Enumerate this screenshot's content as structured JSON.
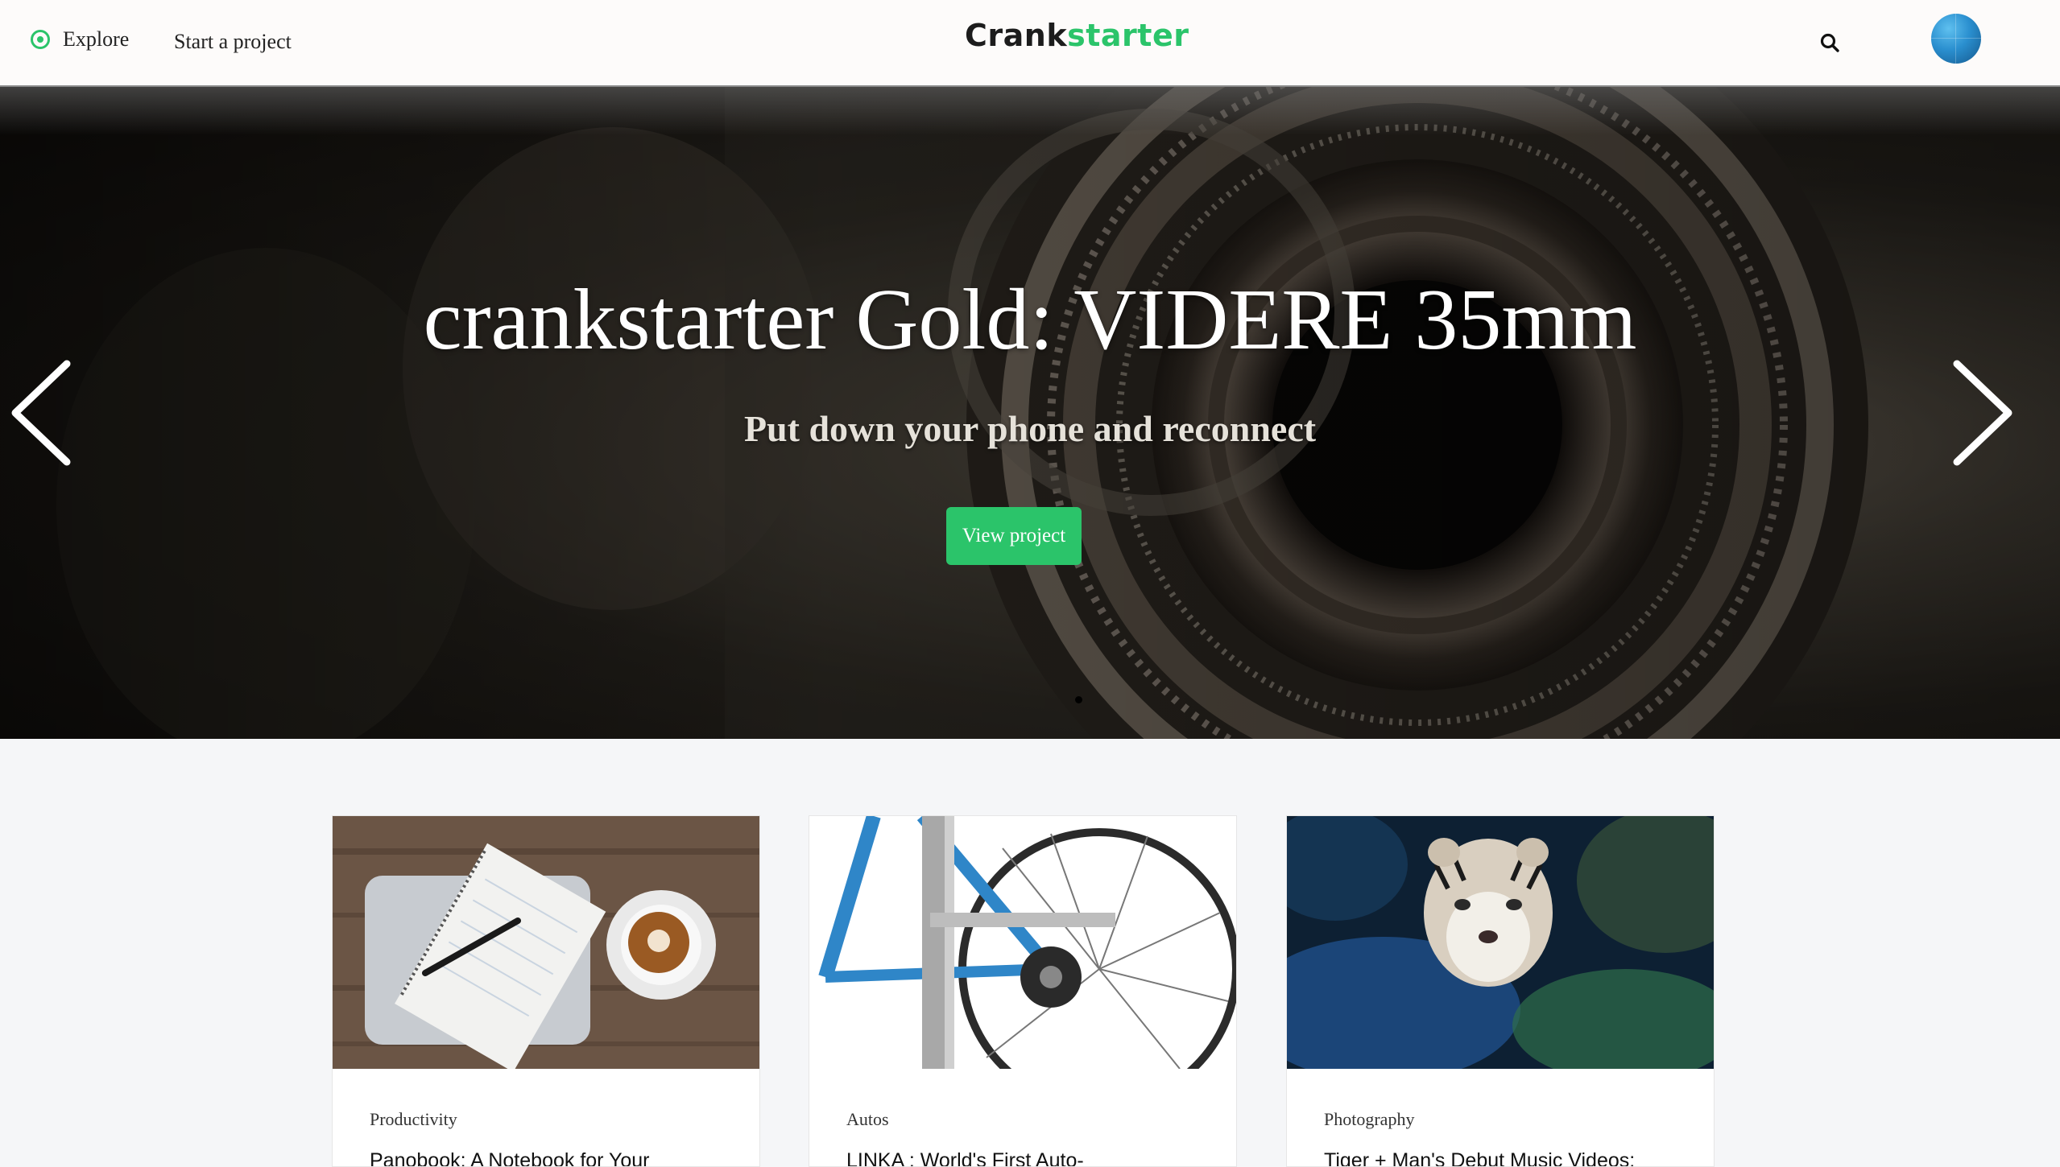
{
  "nav": {
    "explore": "Explore",
    "start_project": "Start a project",
    "logo_part1": "Crank",
    "logo_part2": "starter",
    "search_icon": "search-icon",
    "avatar_icon": "globe-avatar"
  },
  "hero": {
    "title": "crankstarter Gold: VIDERE 35mm",
    "subtitle": "Put down your phone and reconnect",
    "button": "View project",
    "prev_icon": "chevron-left-icon",
    "next_icon": "chevron-right-icon"
  },
  "cards": [
    {
      "category": "Productivity",
      "title": "Panobook: A Notebook for Your"
    },
    {
      "category": "Autos",
      "title": "LINKA : World's First Auto-"
    },
    {
      "category": "Photography",
      "title": "Tiger + Man's Debut Music Videos:"
    }
  ],
  "colors": {
    "accent": "#2bc46a",
    "nav_bg": "#fdfbfa",
    "page_bg": "#f5f6f8"
  }
}
